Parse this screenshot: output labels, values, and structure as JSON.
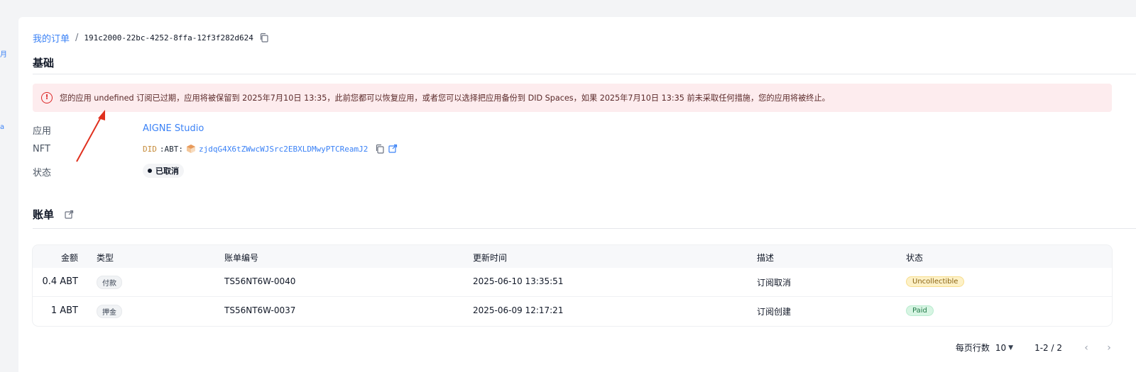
{
  "breadcrumb": {
    "parent_label": "我的订单",
    "separator": "/",
    "order_id": "191c2000-22bc-4252-8ffa-12f3f282d624"
  },
  "basic_section": {
    "title": "基础",
    "alert": {
      "icon": "alert-circle-icon",
      "text": "您的应用 undefined 订阅已过期，应用将被保留到 2025年7月10日 13:35，此前您都可以恢复应用，或者您可以选择把应用备份到 DID Spaces，如果 2025年7月10日 13:35 前未采取任何措施，您的应用将被终止。"
    },
    "fields": {
      "app_label": "应用",
      "app_value": "AIGNE Studio",
      "nft_label": "NFT",
      "nft_prefix": "DID",
      "nft_chain": ":ABT:",
      "nft_address": "zjdqG4X6tZWwcWJSrc2EBXLDMwyPTCReamJ2",
      "status_label": "状态",
      "status_value": "已取消"
    }
  },
  "bills_section": {
    "title": "账单",
    "table": {
      "columns": [
        "金额",
        "类型",
        "账单编号",
        "更新时间",
        "描述",
        "状态"
      ],
      "rows": [
        {
          "amount": "0.4 ABT",
          "type": "付款",
          "number": "TS56NT6W-0040",
          "updated": "2025-06-10 13:35:51",
          "desc": "订阅取消",
          "status": "Uncollectible"
        },
        {
          "amount": "1 ABT",
          "type": "押金",
          "number": "TS56NT6W-0037",
          "updated": "2025-06-09 12:17:21",
          "desc": "订阅创建",
          "status": "Paid"
        }
      ]
    }
  },
  "pagination": {
    "rows_per_page_label": "每页行数",
    "rows_per_page_value": "10",
    "range": "1-2 / 2"
  },
  "colors": {
    "link": "#3b82f6",
    "alert_bg": "#fdecee",
    "alert_icon": "#dc2626",
    "uncollectible_bg": "#fdf1c7",
    "paid_bg": "#d7f5e3",
    "annotation_arrow": "#e0301e"
  }
}
